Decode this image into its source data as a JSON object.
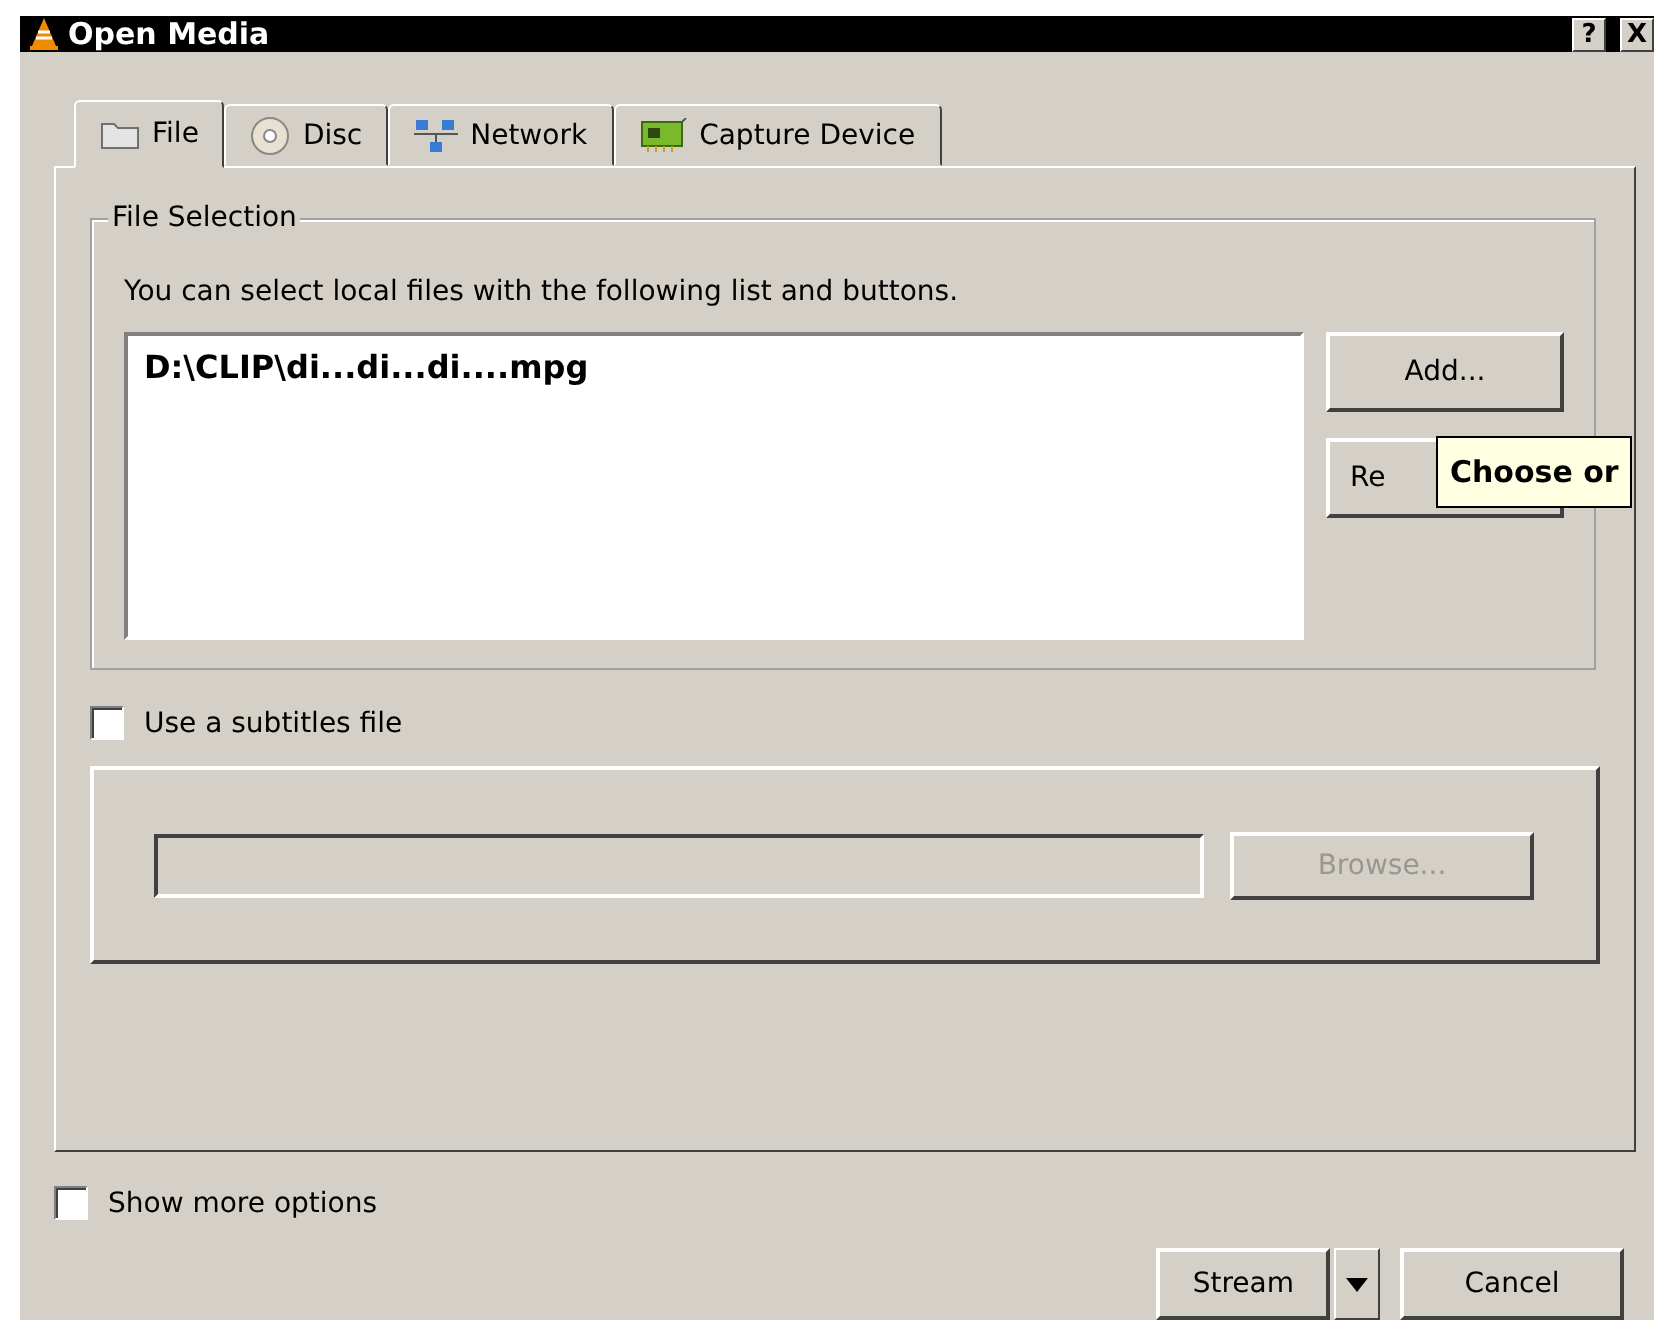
{
  "window": {
    "title": "Open Media",
    "buttons": [
      {
        "kind": "help",
        "label": "?"
      },
      {
        "kind": "close",
        "label": "X"
      }
    ]
  },
  "tabs": [
    {
      "label": "File",
      "kind": "folder",
      "selected": true
    },
    {
      "label": "Disc",
      "kind": "disc",
      "selected": false
    },
    {
      "label": "Network",
      "kind": "network",
      "selected": false
    },
    {
      "label": "Capture Device",
      "kind": "card",
      "selected": false
    }
  ],
  "file_selection": {
    "title": "File Selection",
    "hint": "You can select local files with the following list and buttons.",
    "files": [
      "D:\\CLIP\\di...di...di....mpg"
    ],
    "add_button": "Add...",
    "remove_button": "Re",
    "tooltip": "Choose or"
  },
  "subtitles": {
    "label": "Use a subtitles file",
    "checked": false,
    "browse_button": "Browse...",
    "browse_disabled": true
  },
  "show_more_options": {
    "label": "Show more options",
    "checked": false
  },
  "buttons": [
    {
      "kind": "split",
      "label": "Stream"
    },
    {
      "kind": "plain",
      "label": "Cancel"
    }
  ]
}
